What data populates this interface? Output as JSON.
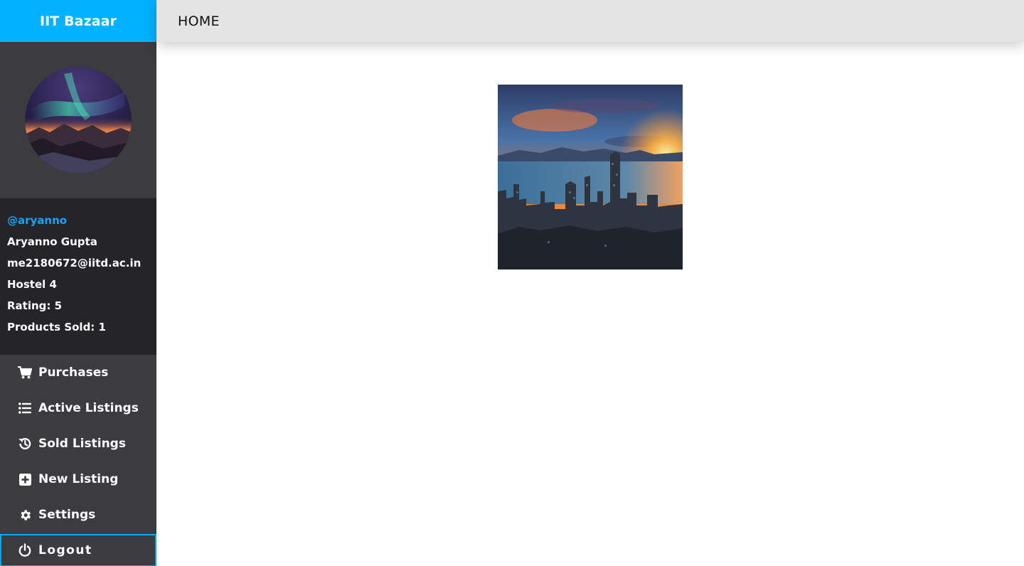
{
  "app": {
    "brand": "IIT Bazaar",
    "nav_home": "HOME"
  },
  "profile": {
    "handle": "@aryanno",
    "name": "Aryanno Gupta",
    "email": "me2180672@iitd.ac.in",
    "hostel": "Hostel 4",
    "rating": "Rating: 5",
    "products_sold": "Products Sold: 1"
  },
  "menu": {
    "items": [
      {
        "label": "Purchases",
        "icon": "shopping-cart-icon"
      },
      {
        "label": "Active Listings",
        "icon": "list-icon"
      },
      {
        "label": "Sold Listings",
        "icon": "history-icon"
      },
      {
        "label": "New Listing",
        "icon": "plus-square-icon"
      },
      {
        "label": "Settings",
        "icon": "gear-icon"
      },
      {
        "label": "Logout",
        "icon": "power-icon"
      }
    ]
  },
  "colors": {
    "brand_bg": "#00b2ff",
    "topbar_bg": "#e4e4e4",
    "sidebar_bg": "#3c3b40",
    "profile_bg": "#252429",
    "handle": "#1aa3f0",
    "logout_border": "#00a8f0"
  }
}
